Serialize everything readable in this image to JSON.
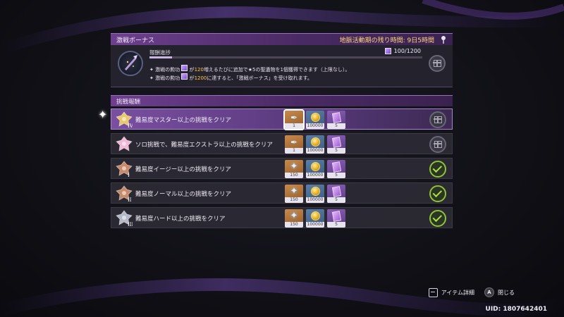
{
  "event_bonus": {
    "title": "激戦ボーナス",
    "time_left_label": "地脈活動期の残り時間: 9日5時間",
    "progress_label": "報酬進捗",
    "progress_value_text": "100/1200",
    "progress_fraction": 0.083,
    "bullets": [
      {
        "pre": "激戦の勲功 ",
        "mid": " が",
        "hl": "120",
        "post": "増えるたびに追加で★5の聖遺物を1個獲得できます（上限なし）。"
      },
      {
        "pre": "激戦の勲功 ",
        "mid": " が",
        "hl": "1200",
        "post": "に達すると、「激戦ボーナス」を受け取れます。"
      }
    ],
    "claim_icon": "gift-icon"
  },
  "challenge_rewards": {
    "title": "挑戦報酬",
    "rows": [
      {
        "medal_rank": "IV",
        "medal_color": "#e8c86a",
        "text": "難易度マスター以上の挑戦をクリア",
        "selected": true,
        "status": "gift",
        "rewards": [
          {
            "icon": "artifact-quill-icon",
            "rarity": "orange",
            "count": "1"
          },
          {
            "icon": "mora-coin-icon",
            "rarity": "blue",
            "count": "100000"
          },
          {
            "icon": "book-icon",
            "rarity": "purple",
            "count": "5"
          }
        ]
      },
      {
        "medal_rank": "",
        "medal_color": "#f2b8d8",
        "text": "ソロ挑戦で、難易度エクストラ以上の挑戦をクリア",
        "selected": false,
        "status": "gift",
        "rewards": [
          {
            "icon": "artifact-quill-icon",
            "rarity": "orange",
            "count": "1"
          },
          {
            "icon": "mora-coin-icon",
            "rarity": "blue",
            "count": "100000"
          },
          {
            "icon": "book-icon",
            "rarity": "purple",
            "count": "5"
          }
        ]
      },
      {
        "medal_rank": "I",
        "medal_color": "#c98a6a",
        "text": "難易度イージー以上の挑戦をクリア",
        "selected": false,
        "status": "done",
        "rewards": [
          {
            "icon": "primogem-icon",
            "rarity": "orange",
            "count": "150"
          },
          {
            "icon": "mora-coin-icon",
            "rarity": "blue",
            "count": "100000"
          },
          {
            "icon": "book-icon",
            "rarity": "purple",
            "count": "5"
          }
        ]
      },
      {
        "medal_rank": "II",
        "medal_color": "#c98a6a",
        "text": "難易度ノーマル以上の挑戦をクリア",
        "selected": false,
        "status": "done",
        "rewards": [
          {
            "icon": "primogem-icon",
            "rarity": "orange",
            "count": "150"
          },
          {
            "icon": "mora-coin-icon",
            "rarity": "blue",
            "count": "100000"
          },
          {
            "icon": "book-icon",
            "rarity": "purple",
            "count": "5"
          }
        ]
      },
      {
        "medal_rank": "III",
        "medal_color": "#b4b8c8",
        "text": "難易度ハード以上の挑戦をクリア",
        "selected": false,
        "status": "done",
        "rewards": [
          {
            "icon": "primogem-icon",
            "rarity": "orange",
            "count": "150"
          },
          {
            "icon": "mora-coin-icon",
            "rarity": "blue",
            "count": "100000"
          },
          {
            "icon": "book-icon",
            "rarity": "purple",
            "count": "5"
          }
        ]
      }
    ]
  },
  "footer": {
    "item_detail_label": "アイテム詳細",
    "close_key": "A",
    "close_label": "閉じる"
  },
  "uid_text": "UID: 1807642401"
}
